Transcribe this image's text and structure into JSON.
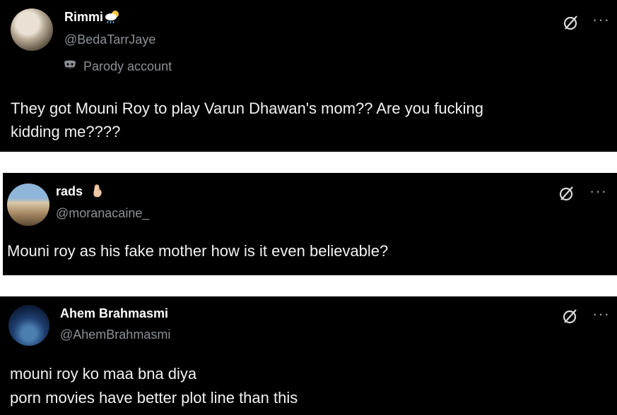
{
  "posts": [
    {
      "name": "Rimmi",
      "name_emoji": "cloud-with-rain-icon",
      "handle": "@BedaTarrJaye",
      "badge": "Parody account",
      "text_lines": [
        "They got Mouni Roy to play Varun Dhawan's mom?? Are you fucking",
        "kidding me????"
      ]
    },
    {
      "name": "rads",
      "name_emoji": "pinched-fingers-hand-icon",
      "handle": "@moranacaine_",
      "text_lines": [
        "Mouni roy as his fake mother how is it even believable?"
      ]
    },
    {
      "name": "Ahem Brahmasmi",
      "handle": "@AhemBrahmasmi",
      "text_lines": [
        "mouni roy ko maa bna diya",
        "porn movies have better plot line than this"
      ]
    }
  ],
  "more_glyph": "···",
  "colors": {
    "card_bg": "#000000",
    "text_primary": "#e7e9ea",
    "text_secondary": "#8b9196",
    "page_bg": "#ffffff"
  }
}
